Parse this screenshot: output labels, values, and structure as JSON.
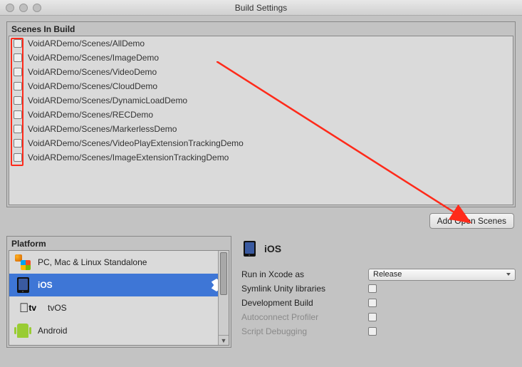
{
  "window": {
    "title": "Build Settings"
  },
  "scenes": {
    "panel_label": "Scenes In Build",
    "items": [
      {
        "path": "VoidARDemo/Scenes/AllDemo"
      },
      {
        "path": "VoidARDemo/Scenes/ImageDemo"
      },
      {
        "path": "VoidARDemo/Scenes/VideoDemo"
      },
      {
        "path": "VoidARDemo/Scenes/CloudDemo"
      },
      {
        "path": "VoidARDemo/Scenes/DynamicLoadDemo"
      },
      {
        "path": "VoidARDemo/Scenes/RECDemo"
      },
      {
        "path": "VoidARDemo/Scenes/MarkerlessDemo"
      },
      {
        "path": "VoidARDemo/Scenes/VideoPlayExtensionTrackingDemo"
      },
      {
        "path": "VoidARDemo/Scenes/ImageExtensionTrackingDemo"
      }
    ],
    "add_button_label": "Add Open Scenes"
  },
  "platform": {
    "panel_label": "Platform",
    "items": [
      {
        "label": "PC, Mac & Linux Standalone",
        "icon": "pc"
      },
      {
        "label": "iOS",
        "icon": "tablet",
        "selected": true,
        "unity_badge": true
      },
      {
        "label": "tvOS",
        "icon": "appletv"
      },
      {
        "label": "Android",
        "icon": "android"
      }
    ]
  },
  "detail": {
    "title": "iOS",
    "rows": [
      {
        "label": "Run in Xcode as",
        "type": "select",
        "value": "Release"
      },
      {
        "label": "Symlink Unity libraries",
        "type": "check"
      },
      {
        "label": "Development Build",
        "type": "check"
      },
      {
        "label": "Autoconnect Profiler",
        "type": "check",
        "disabled": true
      },
      {
        "label": "Script Debugging",
        "type": "check",
        "disabled": true
      }
    ]
  }
}
